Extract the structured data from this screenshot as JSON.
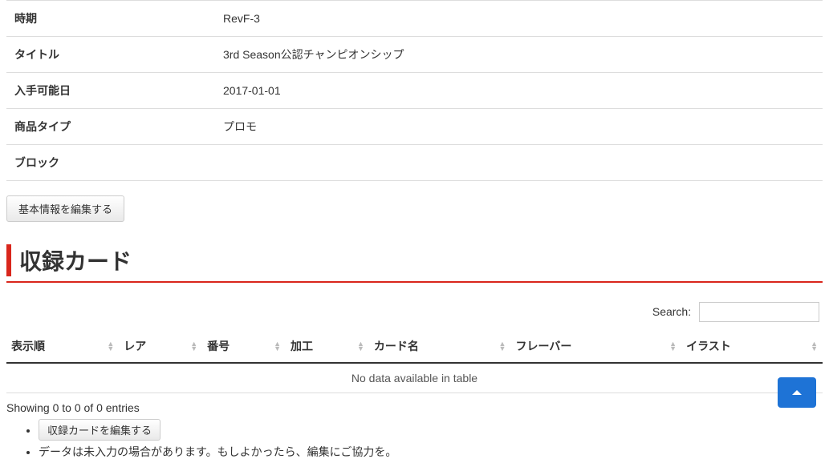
{
  "info": {
    "rows": [
      {
        "label": "時期",
        "value": "RevF-3"
      },
      {
        "label": "タイトル",
        "value": "3rd Season公認チャンピオンシップ"
      },
      {
        "label": "入手可能日",
        "value": "2017-01-01"
      },
      {
        "label": "商品タイプ",
        "value": "プロモ"
      },
      {
        "label": "ブロック",
        "value": ""
      }
    ],
    "edit_button": "基本情報を編集する"
  },
  "section": {
    "heading": "収録カード"
  },
  "search": {
    "label": "Search:",
    "value": ""
  },
  "table": {
    "columns": [
      "表示順",
      "レア",
      "番号",
      "加工",
      "カード名",
      "フレーバー",
      "イラスト"
    ],
    "empty_message": "No data available in table"
  },
  "footer": {
    "info": "Showing 0 to 0 of 0 entries",
    "edit_cards_button": "収録カードを編集する",
    "note": "データは未入力の場合があります。もしよかったら、編集にご協力を。"
  }
}
